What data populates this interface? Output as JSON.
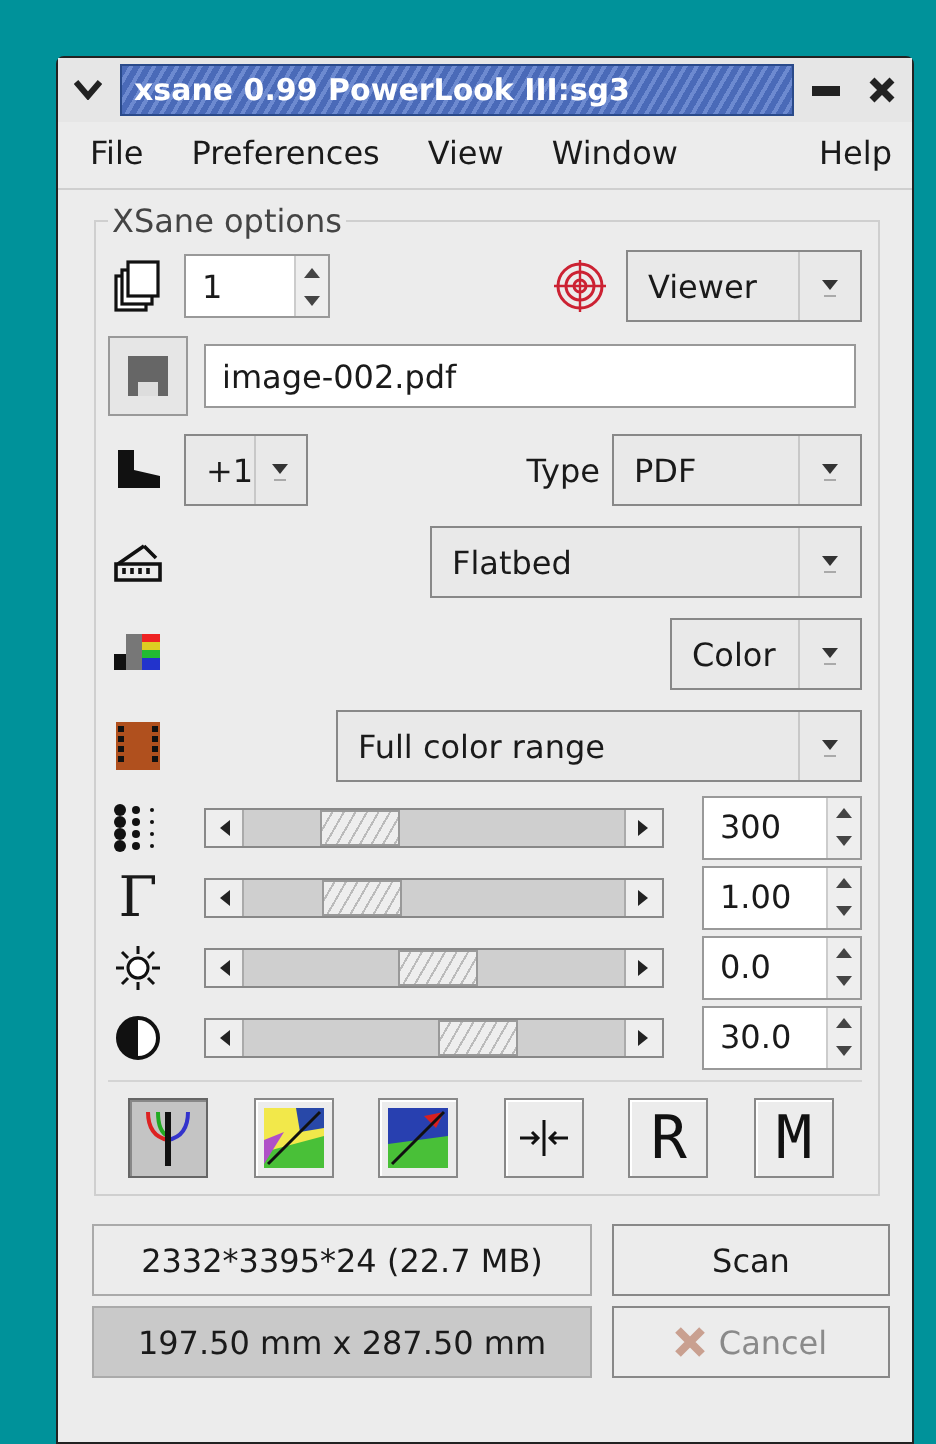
{
  "window": {
    "title": "xsane 0.99 PowerLook III:sg3"
  },
  "menu": [
    "File",
    "Preferences",
    "View",
    "Window",
    "Help"
  ],
  "options": {
    "title": "XSane options",
    "copies": "1",
    "preview": "Viewer",
    "filename": "image-002.pdf",
    "step": "+1",
    "type_label": "Type",
    "type": "PDF",
    "source": "Flatbed",
    "mode": "Color",
    "range": "Full color range",
    "sliders": [
      {
        "kind": "resolution",
        "level": 0.25,
        "value": "300"
      },
      {
        "kind": "gamma",
        "symbol": "Γ",
        "level": 0.26,
        "value": "1.00"
      },
      {
        "kind": "brightness",
        "level": 0.51,
        "value": "0.0"
      },
      {
        "kind": "contrast",
        "level": 0.65,
        "value": "30.0"
      }
    ],
    "tools": [
      {
        "kind": "histogram",
        "selected": true
      },
      {
        "kind": "enhance-auto",
        "selected": false
      },
      {
        "kind": "enhance-default",
        "selected": false
      },
      {
        "kind": "restore",
        "selected": false
      },
      {
        "kind": "letter",
        "text": "R",
        "selected": false
      },
      {
        "kind": "letter",
        "text": "M",
        "selected": false
      }
    ]
  },
  "info": [
    "2332*3395*24 (22.7 MB)",
    "197.50 mm x 287.50 mm"
  ],
  "buttons": [
    {
      "label": "Scan",
      "disabled": false
    },
    {
      "label": "Cancel",
      "disabled": true
    }
  ]
}
